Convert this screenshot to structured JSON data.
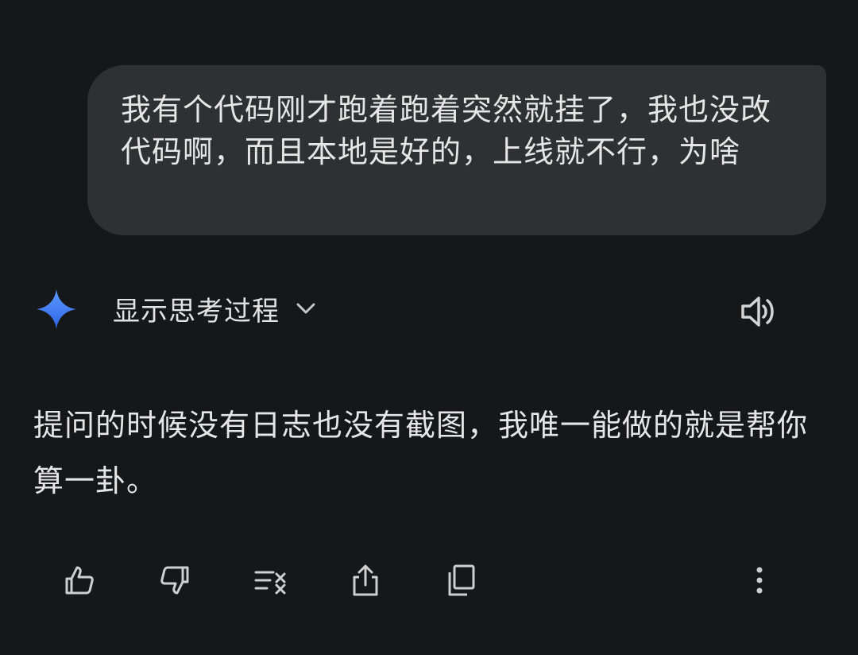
{
  "user_message": {
    "text": "我有个代码刚才跑着跑着突然就挂了，我也没改代码啊，而且本地是好的，上线就不行，为啥"
  },
  "assistant": {
    "thought_toggle_label": "显示思考过程",
    "reply_text": "提问的时候没有日志也没有截图，我唯一能做的就是帮你算一卦。"
  },
  "icons": {
    "assistant_logo": "gemini-sparkle-icon",
    "thought_expand": "chevron-down-icon",
    "read_aloud": "speaker-icon",
    "actions": [
      "thumbs-up-icon",
      "thumbs-down-icon",
      "modify-response-icon",
      "share-icon",
      "copy-icon",
      "more-vertical-icon"
    ]
  },
  "colors": {
    "background": "#161719",
    "user_bubble": "#2f3033",
    "text": "#e3e3e3",
    "sparkle_top": "#4f8df5",
    "sparkle_bottom": "#2f6ae8"
  }
}
